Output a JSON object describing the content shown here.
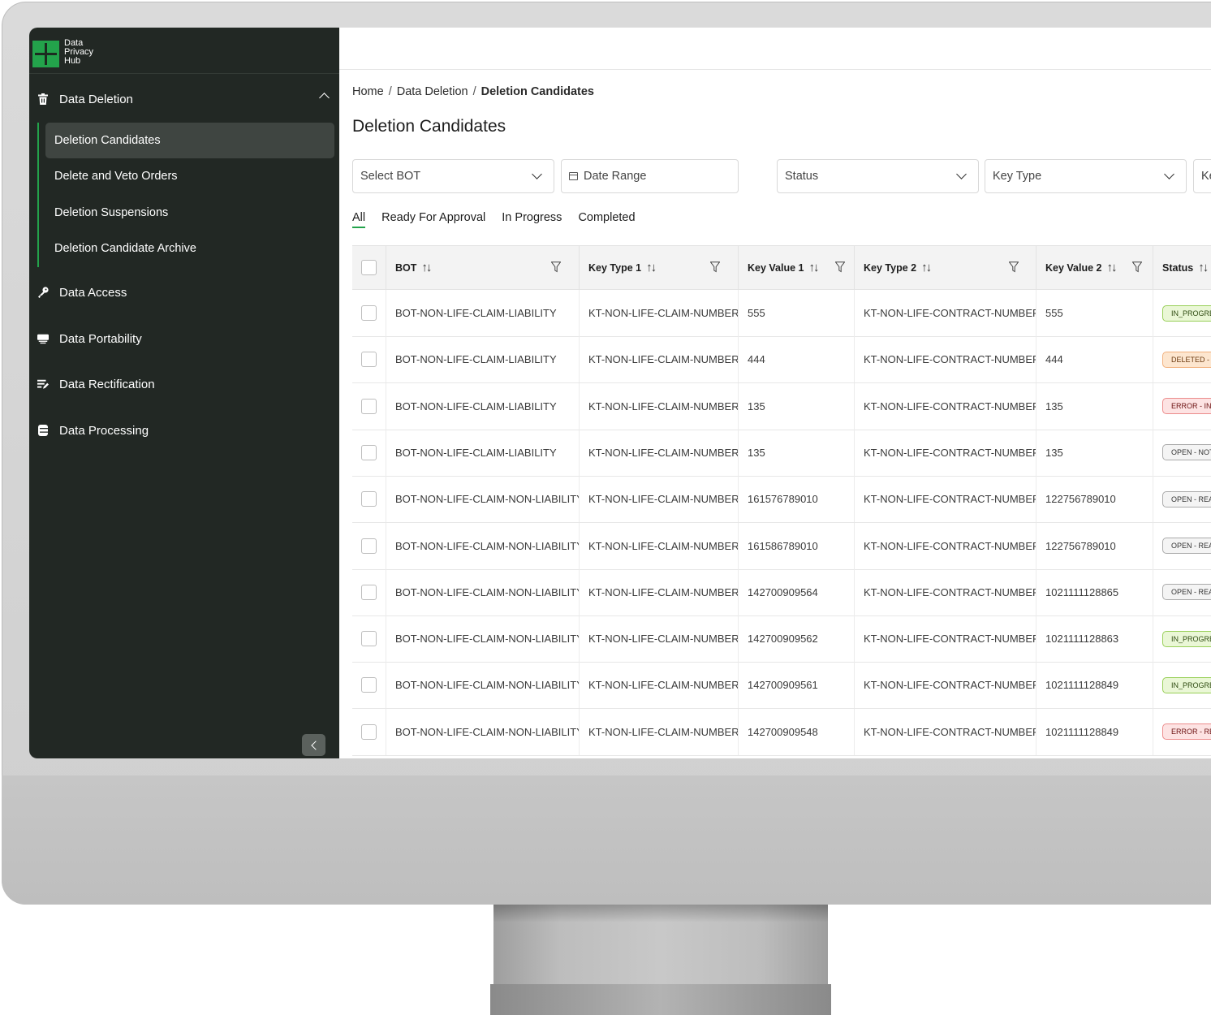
{
  "app": {
    "logo_lines": [
      "Data",
      "Privacy",
      "Hub"
    ],
    "accent_color": "#23a34b"
  },
  "sidebar": {
    "sections": [
      {
        "label": "Data Deletion",
        "icon": "trash-icon",
        "expanded": true
      },
      {
        "label": "Data Access",
        "icon": "key-icon"
      },
      {
        "label": "Data Portability",
        "icon": "transfer-icon"
      },
      {
        "label": "Data Rectification",
        "icon": "edit-list-icon"
      },
      {
        "label": "Data Processing",
        "icon": "database-icon"
      }
    ],
    "deletion_items": [
      {
        "label": "Deletion Candidates",
        "active": true
      },
      {
        "label": "Delete and Veto Orders"
      },
      {
        "label": "Deletion Suspensions"
      },
      {
        "label": "Deletion Candidate Archive"
      }
    ]
  },
  "breadcrumb": [
    "Home",
    "Data Deletion",
    "Deletion Candidates"
  ],
  "page_title": "Deletion Candidates",
  "filters": {
    "bot": "Select BOT",
    "date_range": "Date Range",
    "status": "Status",
    "key_type": "Key Type",
    "extra": "Ke"
  },
  "tabs": [
    "All",
    "Ready For Approval",
    "In Progress",
    "Completed"
  ],
  "active_tab": "All",
  "table": {
    "columns": [
      "BOT",
      "Key Type 1",
      "Key Value 1",
      "Key Type 2",
      "Key Value 2",
      "Status"
    ],
    "rows": [
      {
        "bot": "BOT-NON-LIFE-CLAIM-LIABILITY",
        "kt1": "KT-NON-LIFE-CLAIM-NUMBER",
        "kv1": "555",
        "kt2": "KT-NON-LIFE-CONTRACT-NUMBER",
        "kv2": "555",
        "status": "IN_PROGRE",
        "status_color": "green"
      },
      {
        "bot": "BOT-NON-LIFE-CLAIM-LIABILITY",
        "kt1": "KT-NON-LIFE-CLAIM-NUMBER",
        "kv1": "444",
        "kt2": "KT-NON-LIFE-CONTRACT-NUMBER",
        "kv2": "444",
        "status": "DELETED - C",
        "status_color": "orange"
      },
      {
        "bot": "BOT-NON-LIFE-CLAIM-LIABILITY",
        "kt1": "KT-NON-LIFE-CLAIM-NUMBER",
        "kv1": "135",
        "kt2": "KT-NON-LIFE-CONTRACT-NUMBER",
        "kv2": "135",
        "status": "ERROR - INV",
        "status_color": "red"
      },
      {
        "bot": "BOT-NON-LIFE-CLAIM-LIABILITY",
        "kt1": "KT-NON-LIFE-CLAIM-NUMBER",
        "kv1": "135",
        "kt2": "KT-NON-LIFE-CONTRACT-NUMBER",
        "kv2": "135",
        "status": "OPEN - NOT",
        "status_color": "grey"
      },
      {
        "bot": "BOT-NON-LIFE-CLAIM-NON-LIABILITY",
        "kt1": "KT-NON-LIFE-CLAIM-NUMBER",
        "kv1": "161576789010",
        "kt2": "KT-NON-LIFE-CONTRACT-NUMBER",
        "kv2": "122756789010",
        "status": "OPEN - REA",
        "status_color": "grey"
      },
      {
        "bot": "BOT-NON-LIFE-CLAIM-NON-LIABILITY",
        "kt1": "KT-NON-LIFE-CLAIM-NUMBER",
        "kv1": "161586789010",
        "kt2": "KT-NON-LIFE-CONTRACT-NUMBER",
        "kv2": "122756789010",
        "status": "OPEN - REA",
        "status_color": "grey"
      },
      {
        "bot": "BOT-NON-LIFE-CLAIM-NON-LIABILITY",
        "kt1": "KT-NON-LIFE-CLAIM-NUMBER",
        "kv1": "142700909564",
        "kt2": "KT-NON-LIFE-CONTRACT-NUMBER",
        "kv2": "1021111128865",
        "status": "OPEN - REA",
        "status_color": "grey"
      },
      {
        "bot": "BOT-NON-LIFE-CLAIM-NON-LIABILITY",
        "kt1": "KT-NON-LIFE-CLAIM-NUMBER",
        "kv1": "142700909562",
        "kt2": "KT-NON-LIFE-CONTRACT-NUMBER",
        "kv2": "1021111128863",
        "status": "IN_PROGRE",
        "status_color": "green"
      },
      {
        "bot": "BOT-NON-LIFE-CLAIM-NON-LIABILITY",
        "kt1": "KT-NON-LIFE-CLAIM-NUMBER",
        "kv1": "142700909561",
        "kt2": "KT-NON-LIFE-CONTRACT-NUMBER",
        "kv2": "1021111128849",
        "status": "IN_PROGRE",
        "status_color": "green"
      },
      {
        "bot": "BOT-NON-LIFE-CLAIM-NON-LIABILITY",
        "kt1": "KT-NON-LIFE-CLAIM-NUMBER",
        "kv1": "142700909548",
        "kt2": "KT-NON-LIFE-CONTRACT-NUMBER",
        "kv2": "1021111128849",
        "status": "ERROR - RE",
        "status_color": "red"
      }
    ]
  }
}
